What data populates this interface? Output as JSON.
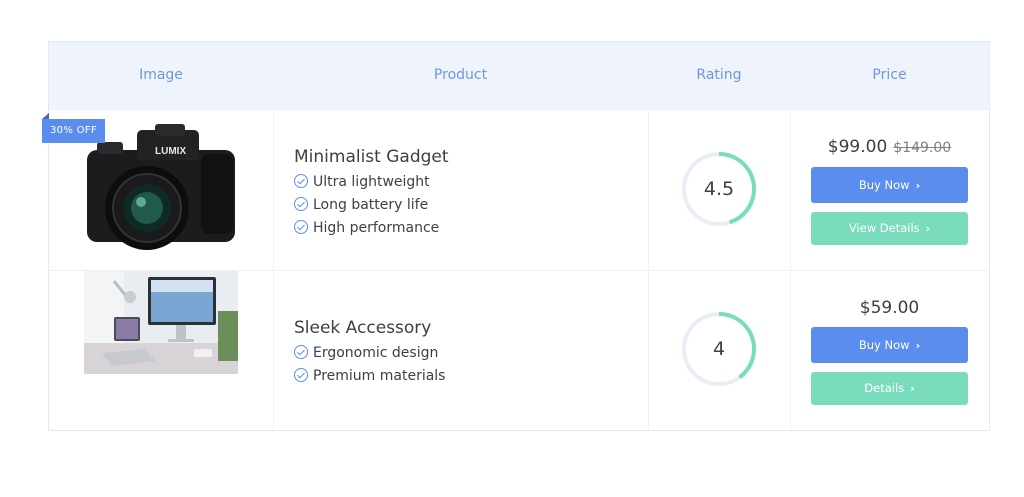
{
  "headers": {
    "image": "Image",
    "product": "Product",
    "rating": "Rating",
    "price": "Price"
  },
  "colors": {
    "accent": "#5b8def",
    "teal": "#79dcbd",
    "header_bg": "#eef3fc",
    "header_text": "#6f97d8"
  },
  "products": [
    {
      "badge": "30% OFF",
      "name": "Minimalist Gadget",
      "features": [
        "Ultra lightweight",
        "Long battery life",
        "High performance"
      ],
      "rating": "4.5",
      "rating_fraction": 0.45,
      "price": "$99.00",
      "old_price": "$149.00",
      "buy_label": "Buy Now",
      "details_label": "View Details",
      "image_text": "LUMIX"
    },
    {
      "name": "Sleek Accessory",
      "features": [
        "Ergonomic design",
        "Premium materials"
      ],
      "rating": "4",
      "rating_fraction": 0.4,
      "price": "$59.00",
      "buy_label": "Buy Now",
      "details_label": "Details"
    }
  ]
}
